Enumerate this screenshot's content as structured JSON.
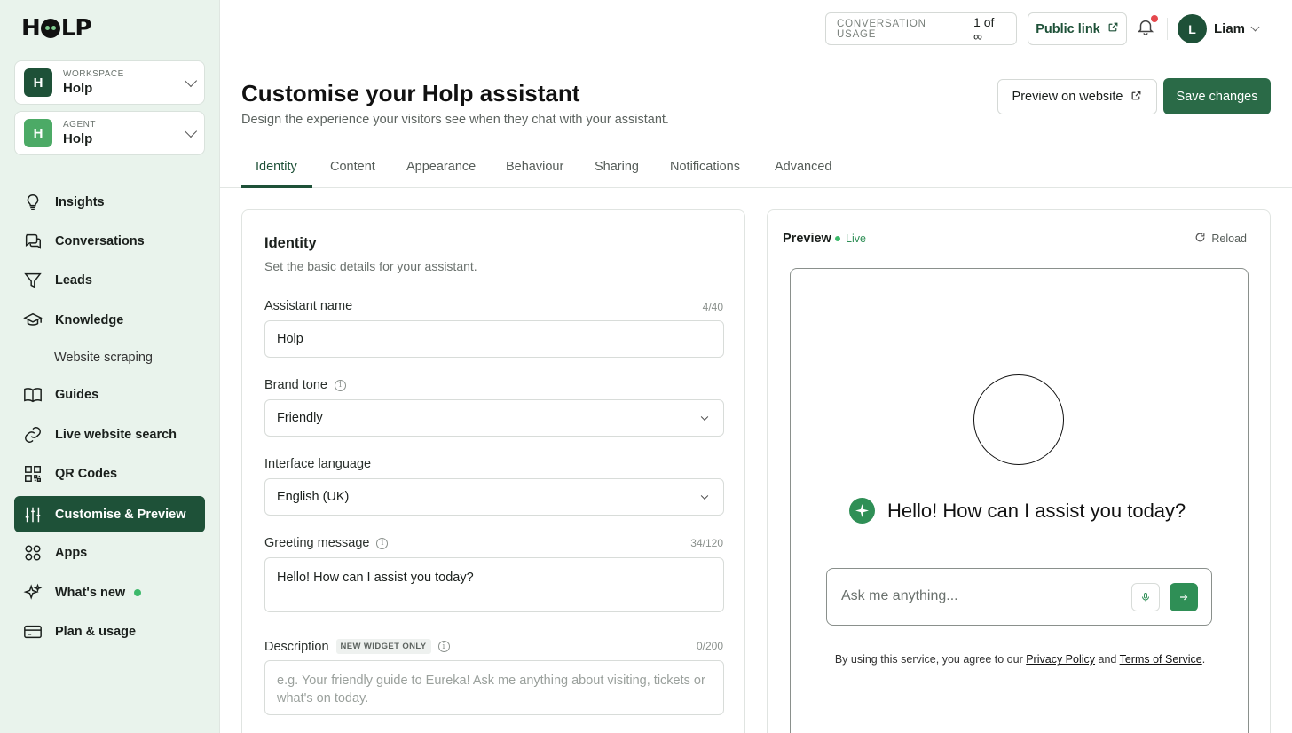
{
  "brand": {
    "logo": "HOLP"
  },
  "workspace": {
    "caption": "WORKSPACE",
    "initial": "H",
    "name": "Holp",
    "color": "#1e5138"
  },
  "agent": {
    "caption": "AGENT",
    "initial": "H",
    "name": "Holp",
    "color": "#4caa66"
  },
  "sidebar": {
    "items": [
      {
        "label": "Insights",
        "icon": "lightbulb-icon"
      },
      {
        "label": "Conversations",
        "icon": "chat-bubbles-icon"
      },
      {
        "label": "Leads",
        "icon": "funnel-icon"
      },
      {
        "label": "Knowledge",
        "icon": "graduation-cap-icon"
      },
      {
        "label": "Website scraping"
      },
      {
        "label": "Guides",
        "icon": "book-icon"
      },
      {
        "label": "Live website search",
        "icon": "link-icon"
      },
      {
        "label": "QR Codes",
        "icon": "qr-code-icon"
      },
      {
        "label": "Customise & Preview",
        "icon": "sliders-icon",
        "active": true
      },
      {
        "label": "Apps",
        "icon": "apps-grid-icon"
      },
      {
        "label": "What's new",
        "icon": "sparkles-icon"
      },
      {
        "label": "Plan & usage",
        "icon": "credit-card-icon"
      }
    ]
  },
  "topbar": {
    "usage_label": "CONVERSATION USAGE",
    "usage_value": "1 of ∞",
    "public_link": "Public link",
    "user_initial": "L",
    "user_name": "Liam"
  },
  "header": {
    "title": "Customise your Holp assistant",
    "subtitle": "Design the experience your visitors see when they chat with your assistant.",
    "preview_button": "Preview on website",
    "save_button": "Save changes"
  },
  "tabs": [
    "Identity",
    "Content",
    "Appearance",
    "Behaviour",
    "Sharing",
    "Notifications",
    "Advanced"
  ],
  "identity": {
    "title": "Identity",
    "subtitle": "Set the basic details for your assistant.",
    "assistant_name_label": "Assistant name",
    "assistant_name_count": "4/40",
    "assistant_name_value": "Holp",
    "brand_tone_label": "Brand tone",
    "brand_tone_value": "Friendly",
    "language_label": "Interface language",
    "language_value": "English (UK)",
    "greeting_label": "Greeting message",
    "greeting_count": "34/120",
    "greeting_value": "Hello! How can I assist you today?",
    "description_label": "Description",
    "description_tag": "NEW WIDGET ONLY",
    "description_count": "0/200",
    "description_placeholder": "e.g. Your friendly guide to Eureka! Ask me anything about visiting, tickets or what's on today."
  },
  "preview": {
    "title": "Preview",
    "status": "Live",
    "reload": "Reload",
    "greeting": "Hello! How can I assist you today?",
    "input_placeholder": "Ask me anything...",
    "terms_prefix": "By using this service, you agree to our",
    "privacy": "Privacy Policy",
    "and": "and",
    "terms": "Terms of Service",
    "terms_suffix": "."
  },
  "colors": {
    "primary": "#1e5138",
    "accent": "#2f8f56",
    "sidebar_bg": "#e9f3ec",
    "alert": "#e5484d"
  }
}
